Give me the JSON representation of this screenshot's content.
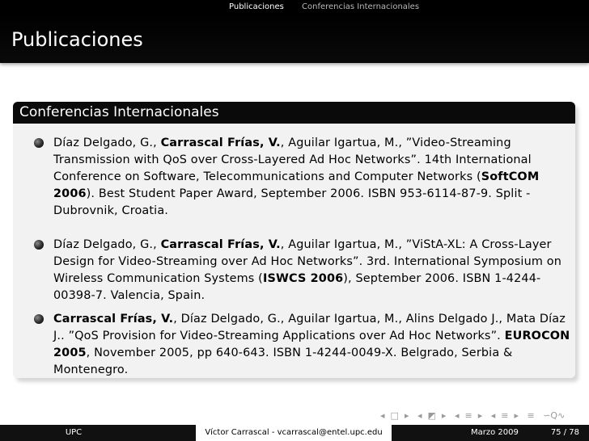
{
  "headline": {
    "section_active": "Publicaciones",
    "section_other": "Conferencias Internacionales"
  },
  "frame_title": "Publicaciones",
  "block_title": "Conferencias Internacionales",
  "references": [
    {
      "segments": [
        {
          "text": "Díaz Delgado, G., ",
          "bold": false
        },
        {
          "text": "Carrascal Frías, V.",
          "bold": true
        },
        {
          "text": ", Aguilar Igartua, M., ”Video-Streaming Transmission with QoS over Cross-Layered Ad Hoc Networks”. 14th International Conference on Software, Telecommunications and Computer Networks (",
          "bold": false
        },
        {
          "text": "SoftCOM 2006",
          "bold": true
        },
        {
          "text": "). Best Student Paper Award, September 2006. ISBN 953-6114-87-9. Split - Dubrovnik, Croatia.",
          "bold": false
        }
      ]
    },
    {
      "segments": [
        {
          "text": "Díaz Delgado, G., ",
          "bold": false
        },
        {
          "text": "Carrascal Frías, V.",
          "bold": true
        },
        {
          "text": ", Aguilar Igartua, M., ”ViStA-XL: A Cross-Layer Design for Video-Streaming over Ad Hoc Networks”. 3rd. International Symposium on Wireless Communication Systems (",
          "bold": false
        },
        {
          "text": "ISWCS 2006",
          "bold": true
        },
        {
          "text": "), September 2006. ISBN 1-4244-00398-7. Valencia, Spain.",
          "bold": false
        }
      ]
    },
    {
      "segments": [
        {
          "text": "Carrascal Frías, V.",
          "bold": true
        },
        {
          "text": ", Díaz Delgado, G., Aguilar Igartua, M., Alins Delgado J., Mata Díaz J.. ”QoS Provision for Video-Streaming Applications over Ad Hoc Networks”. ",
          "bold": false
        },
        {
          "text": "EUROCON 2005",
          "bold": true
        },
        {
          "text": ", November 2005, pp 640-643. ISBN 1-4244-0049-X. Belgrado, Serbia & Montenegro.",
          "bold": false
        }
      ]
    }
  ],
  "footer": {
    "institution": "UPC",
    "author": "Víctor Carrascal - vcarrascal@entel.upc.edu",
    "date": "Marzo 2009",
    "page": "75 / 78"
  },
  "navigation_icons": [
    "frame-left-icon",
    "frame-right-icon",
    "subsection-left-icon",
    "subsection-right-icon",
    "section-left-icon",
    "section-right-icon",
    "outline-icon",
    "search-icon"
  ],
  "colors": {
    "header_bg": "#000000",
    "block_bg": "#f2f2f2",
    "nav_icon": "#9a9a9a"
  }
}
